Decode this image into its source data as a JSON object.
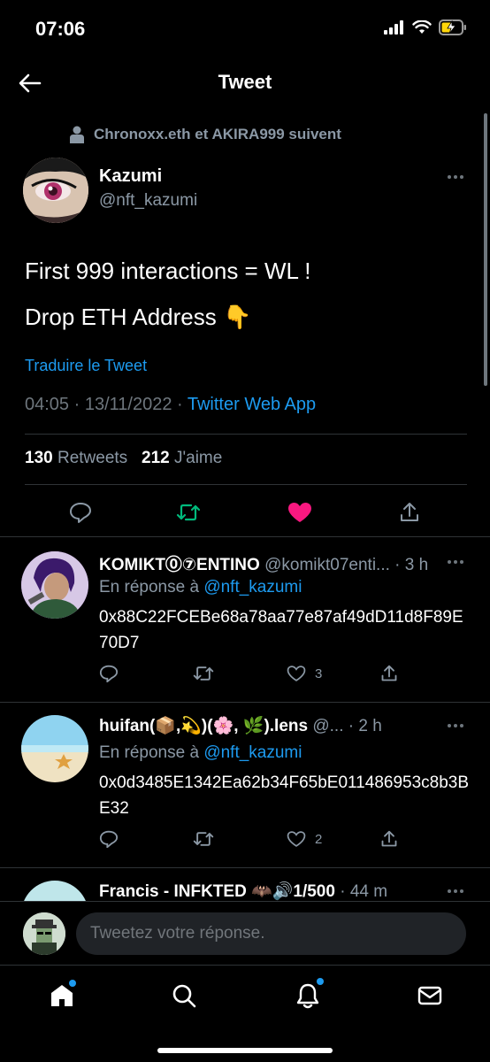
{
  "status_bar": {
    "time": "07:06"
  },
  "header": {
    "title": "Tweet"
  },
  "tweet": {
    "social_context": "Chronoxx.eth et AKIRA999 suivent",
    "author_name": "Kazumi",
    "author_handle": "@nft_kazumi",
    "text_line1": "First 999 interactions = WL !",
    "text_line2": "Drop ETH Address 👇",
    "translate_label": "Traduire le Tweet",
    "timestamp": "04:05 · 13/11/2022 · ",
    "source_app": "Twitter Web App",
    "retweets_count": "130",
    "retweets_label": "Retweets",
    "likes_count": "212",
    "likes_label": "J'aime"
  },
  "replies": [
    {
      "name": "KOMIKT⓪⑦ENTINO",
      "handle": "@komikt07enti...",
      "time": "· 3 h",
      "reply_prefix": "En réponse à",
      "reply_to": "@nft_kazumi",
      "body": "0x88C22FCEBe68a78aa77e87af49dD11d8F89E70D7",
      "likes": "3"
    },
    {
      "name": "huifan(📦,💫)(🌸, 🌿).lens",
      "handle": "@...",
      "time": "· 2 h",
      "reply_prefix": "En réponse à",
      "reply_to": "@nft_kazumi",
      "body": "0x0d3485E1342Ea62b34F65bE011486953c8b3BE32",
      "likes": "2"
    },
    {
      "name": "Francis - INFKTED 🦇🔊1/500",
      "handle": "",
      "time": "· 44 m"
    }
  ],
  "compose": {
    "placeholder": "Tweetez votre réponse."
  },
  "colors": {
    "accent": "#1d9bf0",
    "retweet": "#00ba7c",
    "like": "#f91880"
  }
}
